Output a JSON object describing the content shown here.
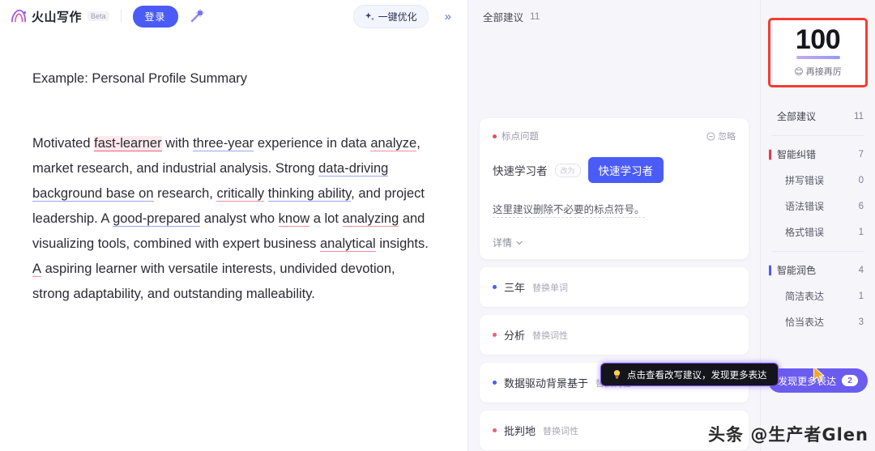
{
  "header": {
    "brand_name": "火山写作",
    "beta_tag": "Beta",
    "login_label": "登录",
    "magic_icon": "magic-wand-icon",
    "optimize_label": "一键优化",
    "collapse_label": "»"
  },
  "document": {
    "title": "Example: Personal Profile Summary",
    "lines": [
      "Motivated fast-learner with three-year experience in data",
      "analyze, market research, and industrial analysis. Strong",
      "data-driving background base on research, critically",
      "thinking ability, and project leadership. A good-prepared",
      "analyst who know a lot analyzing and visualizing tools,",
      "combined with expert business analytical insights. A",
      "aspiring learner with versatile interests, undivided devotion,",
      "strong adaptability, and outstanding malleability."
    ]
  },
  "suggestions_panel": {
    "header_label": "全部建议",
    "header_count": "11",
    "card": {
      "tag": "标点问题",
      "ignore_label": "忽略",
      "original": "快速学习者",
      "arrow_label": "改为",
      "replacement": "快速学习者",
      "description": "这里建议删除不必要的标点符号。",
      "more_label": "详情"
    },
    "rows": [
      {
        "dot": "blue",
        "text": "三年",
        "tag": "替换单词"
      },
      {
        "dot": "pink",
        "text": "分析",
        "tag": "替换词性"
      },
      {
        "dot": "blue",
        "text": "数据驱动背景基于",
        "tag": "替换词性"
      },
      {
        "dot": "pink",
        "text": "批判地",
        "tag": "替换词性"
      }
    ]
  },
  "tooltip": {
    "icon": "lightbulb-icon",
    "text": "点击查看改写建议，发现更多表达"
  },
  "score_panel": {
    "score": "100",
    "emoji": "😊",
    "caption": "再接再厉",
    "highlight_color": "#f53b30"
  },
  "nav": {
    "items": [
      {
        "label": "全部建议",
        "count": "11",
        "level": "top",
        "mark": ""
      },
      {
        "label": "智能纠错",
        "count": "7",
        "level": "group",
        "mark": "red"
      },
      {
        "label": "拼写错误",
        "count": "0",
        "level": "sub",
        "mark": ""
      },
      {
        "label": "语法错误",
        "count": "6",
        "level": "sub",
        "mark": ""
      },
      {
        "label": "格式错误",
        "count": "1",
        "level": "sub",
        "mark": ""
      },
      {
        "label": "智能润色",
        "count": "4",
        "level": "group",
        "mark": "blue"
      },
      {
        "label": "简洁表达",
        "count": "1",
        "level": "sub",
        "mark": ""
      },
      {
        "label": "恰当表达",
        "count": "3",
        "level": "sub",
        "mark": ""
      }
    ],
    "discover_label": "发现更多表达",
    "discover_badge": "2"
  },
  "watermark": "头条 @生产者Glen"
}
